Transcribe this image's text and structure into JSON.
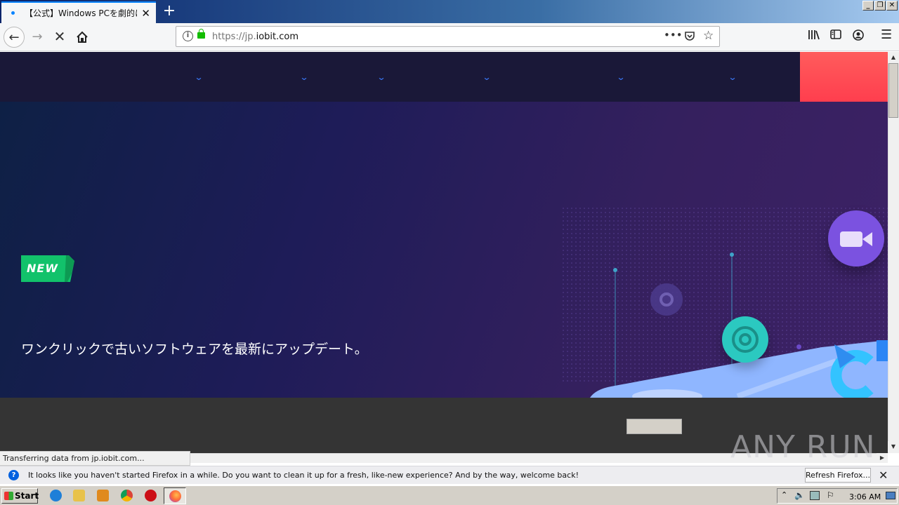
{
  "browser": {
    "tab_title": "【公式】Windows PCを劇的に高速化",
    "url_prefix": "https://jp.",
    "url_domain": "iobit.com",
    "page_actions_icon": "•••"
  },
  "colors": {
    "site_nav_bg": "#1a1838",
    "nav_cta": "#ff4451",
    "badge_green": "#12c26b",
    "dark_band": "#343434"
  },
  "hero": {
    "badge": "NEW",
    "tagline": "ワンクリックで古いソフトウェアを最新にアップデート。"
  },
  "status": {
    "text": "Transferring data from jp.iobit.com..."
  },
  "notification": {
    "message": "It looks like you haven't started Firefox in a while. Do you want to clean it up for a fresh, like-new experience? And by the way, welcome back!",
    "button": "Refresh Firefox..."
  },
  "taskbar": {
    "start": "Start",
    "clock": "3:06 AM"
  },
  "watermark": "ANY RUN"
}
